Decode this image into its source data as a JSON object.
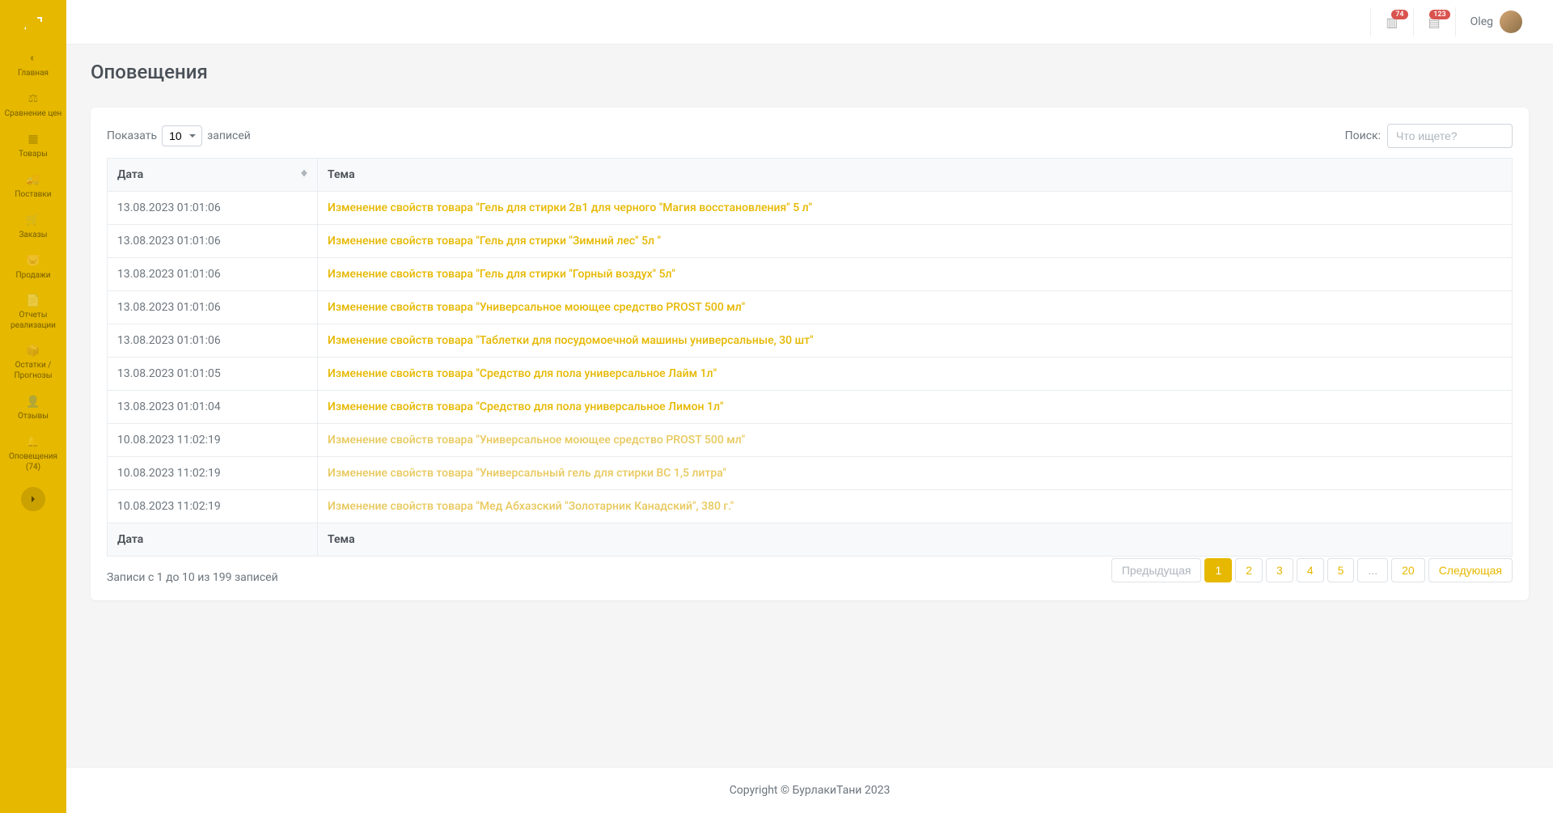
{
  "sidebar": {
    "items": [
      {
        "label": "Главная"
      },
      {
        "label": "Сравнение цен"
      },
      {
        "label": "Товары"
      },
      {
        "label": "Поставки"
      },
      {
        "label": "Заказы"
      },
      {
        "label": "Продажи"
      },
      {
        "label": "Отчеты реализации"
      },
      {
        "label": "Остатки / Прогнозы"
      },
      {
        "label": "Отзывы"
      },
      {
        "label": "Оповещения (74)"
      }
    ]
  },
  "header": {
    "badge1": "74",
    "badge2": "123",
    "user": "Oleg"
  },
  "page": {
    "title": "Оповещения"
  },
  "table": {
    "length_prefix": "Показать",
    "length_value": "10",
    "length_suffix": "записей",
    "search_label": "Поиск:",
    "search_placeholder": "Что ищете?",
    "col_date": "Дата",
    "col_topic": "Тема",
    "rows": [
      {
        "date": "13.08.2023 01:01:06",
        "topic": "Изменение свойств товара \"Гель для стирки 2в1 для черного \"Магия восстановления\" 5 л\"",
        "faded": false
      },
      {
        "date": "13.08.2023 01:01:06",
        "topic": "Изменение свойств товара \"Гель для стирки \"Зимний лес\" 5л \"",
        "faded": false
      },
      {
        "date": "13.08.2023 01:01:06",
        "topic": "Изменение свойств товара \"Гель для стирки \"Горный воздух\" 5л\"",
        "faded": false
      },
      {
        "date": "13.08.2023 01:01:06",
        "topic": "Изменение свойств товара \"Универсальное моющее средство PROST 500 мл\"",
        "faded": false
      },
      {
        "date": "13.08.2023 01:01:06",
        "topic": "Изменение свойств товара \"Таблетки для посудомоечной машины универсальные, 30 шт\"",
        "faded": false
      },
      {
        "date": "13.08.2023 01:01:05",
        "topic": "Изменение свойств товара \"Средство для пола универсальное Лайм 1л\"",
        "faded": false
      },
      {
        "date": "13.08.2023 01:01:04",
        "topic": "Изменение свойств товара \"Средство для пола универсальное Лимон 1л\"",
        "faded": false
      },
      {
        "date": "10.08.2023 11:02:19",
        "topic": "Изменение свойств товара \"Универсальное моющее средство PROST 500 мл\"",
        "faded": true
      },
      {
        "date": "10.08.2023 11:02:19",
        "topic": "Изменение свойств товара \"Универсальный гель для стирки ВС 1,5 литра\"",
        "faded": true
      },
      {
        "date": "10.08.2023 11:02:19",
        "topic": "Изменение свойств товара \"Мед Абхазский \"Золотарник Канадский\", 380 г.\"",
        "faded": true
      }
    ],
    "info": "Записи с 1 до 10 из 199 записей",
    "pagination": {
      "prev": "Предыдущая",
      "next": "Следующая",
      "pages": [
        "1",
        "2",
        "3",
        "4",
        "5",
        "...",
        "20"
      ]
    }
  },
  "footer": "Copyright © БурлакиТани 2023"
}
